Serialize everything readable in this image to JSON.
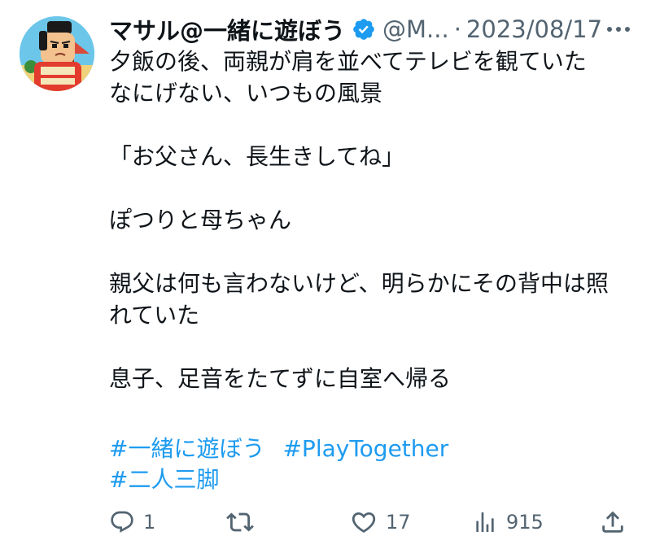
{
  "user": {
    "display_name": "マサル@一緒に遊ぼう",
    "handle": "@M...",
    "separator": "·",
    "date": "2023/08/17",
    "avatar_icon": "samurai-avatar",
    "verified_icon": "verified-badge-icon",
    "verified_color": "#1d9bf0"
  },
  "body": {
    "lines": [
      "夕飯の後、両親が肩を並べてテレビを観ていた",
      "なにげない、いつもの風景",
      "",
      "「お父さん、長生きしてね」",
      "",
      "ぽつりと母ちゃん",
      "",
      "親父は何も言わないけど、明らかにその背中は照",
      "れていた",
      "",
      "息子、足音をたてずに自室へ帰る"
    ],
    "hashtags": [
      "#一緒に遊ぼう",
      "#PlayTogether",
      "#二人三脚"
    ]
  },
  "actions": {
    "reply": {
      "icon": "reply-icon",
      "count": "1"
    },
    "retweet": {
      "icon": "retweet-icon",
      "count": ""
    },
    "like": {
      "icon": "heart-icon",
      "count": "17"
    },
    "views": {
      "icon": "views-icon",
      "count": "915"
    },
    "share": {
      "icon": "share-icon",
      "count": ""
    }
  },
  "colors": {
    "text": "#0f1419",
    "secondary": "#536471",
    "link": "#1d9bf0"
  }
}
